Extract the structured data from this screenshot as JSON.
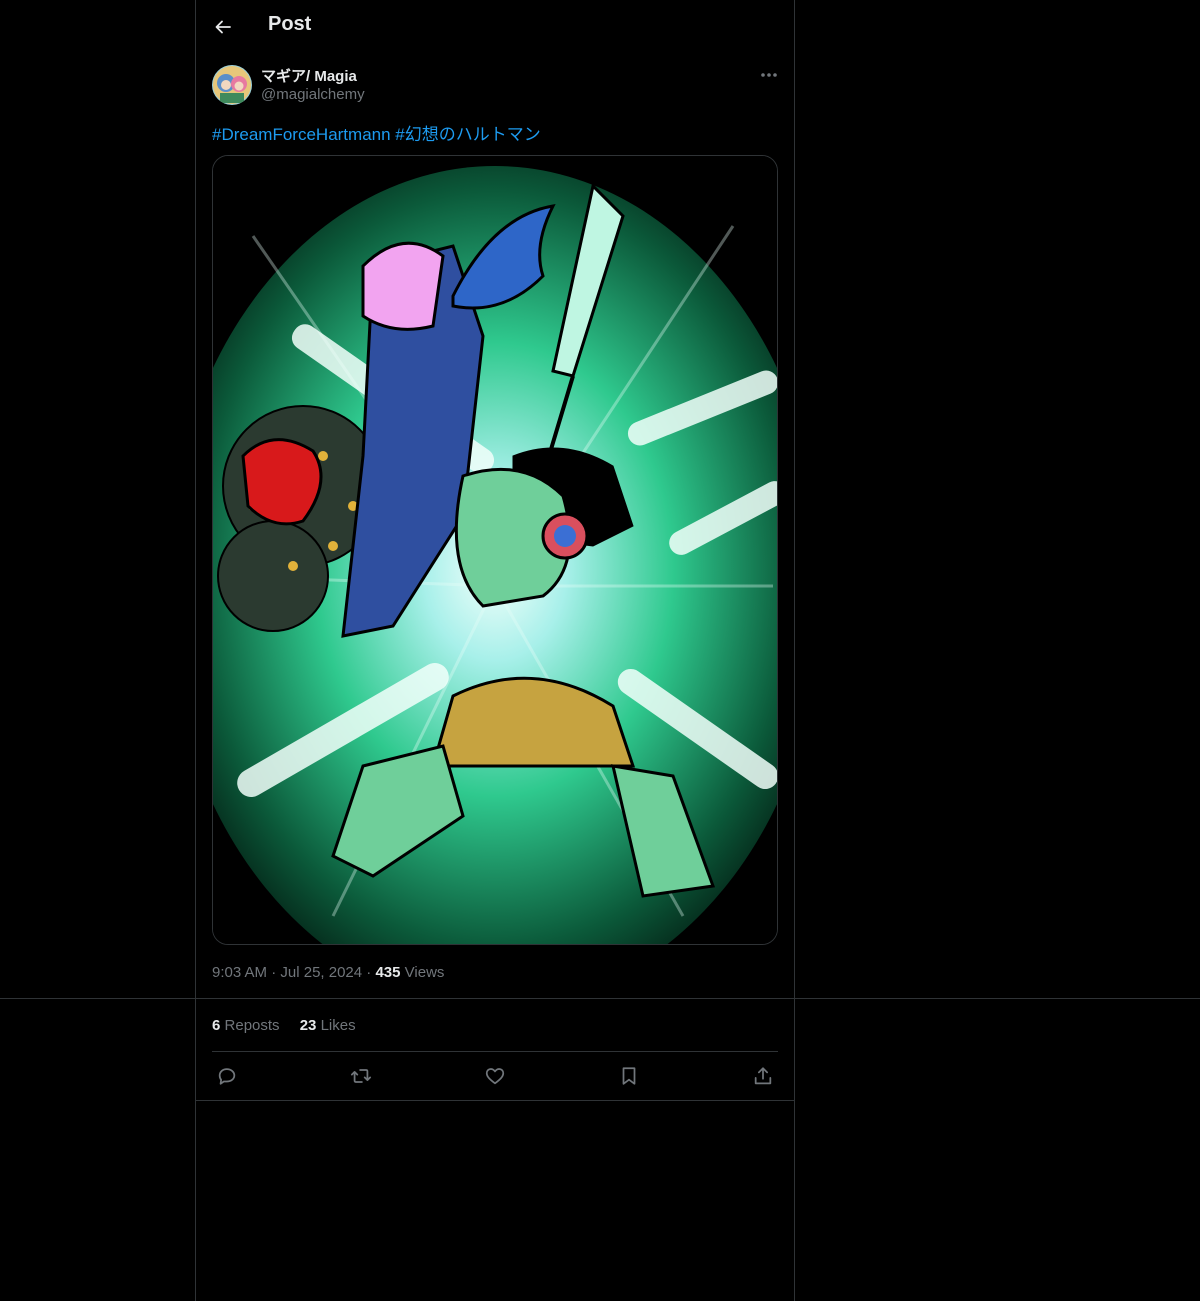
{
  "header": {
    "title": "Post"
  },
  "post": {
    "author": {
      "display_name": "マギア/ Magia",
      "handle": "@magialchemy"
    },
    "hashtags": [
      "#DreamForceHartmann",
      "#幻想のハルトマン"
    ],
    "time": "9:03 AM",
    "date": "Jul 25, 2024",
    "views_count": "435",
    "views_label": "Views"
  },
  "stats": {
    "reposts_count": "6",
    "reposts_label": "Reposts",
    "likes_count": "23",
    "likes_label": "Likes"
  },
  "icons": {
    "back": "arrow-left-icon",
    "more": "more-dots-icon",
    "reply": "reply-bubble-icon",
    "repost": "repost-icon",
    "like": "heart-icon",
    "bookmark": "bookmark-icon",
    "share": "share-icon"
  },
  "colors": {
    "background": "#000000",
    "text": "#e7e9ea",
    "muted": "#71767b",
    "link": "#1d9bf0",
    "border": "#2f3336"
  }
}
